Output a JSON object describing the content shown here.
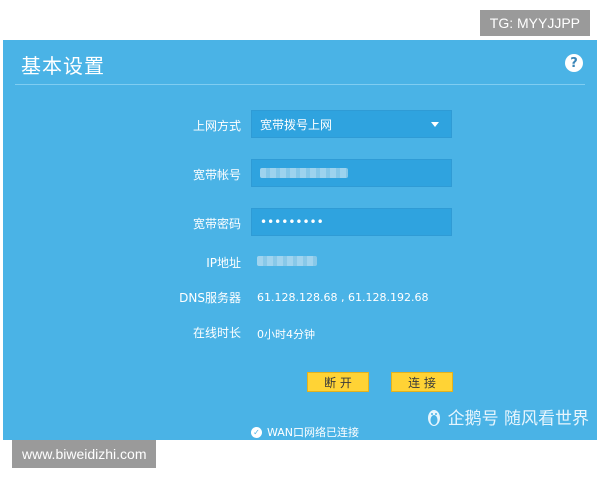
{
  "watermarks": {
    "tg": "TG: MYYJJPP",
    "url": "www.biweidizhi.com",
    "brand": "企鹅号 随风看世界"
  },
  "panel": {
    "title": "基本设置",
    "help": "?"
  },
  "form": {
    "access_mode_label": "上网方式",
    "access_mode_value": "宽带拨号上网",
    "account_label": "宽带帐号",
    "password_label": "宽带密码",
    "password_value": "•••••••••",
    "ip_label": "IP地址",
    "dns_label": "DNS服务器",
    "dns_value": "61.128.128.68 , 61.128.192.68",
    "online_label": "在线时长",
    "online_value": "0小时4分钟"
  },
  "buttons": {
    "disconnect": "断 开",
    "connect": "连 接"
  },
  "status": {
    "text": "WAN口网络已连接"
  },
  "colors": {
    "panel_bg": "#4ab3e6",
    "button_bg": "#ffd335"
  }
}
